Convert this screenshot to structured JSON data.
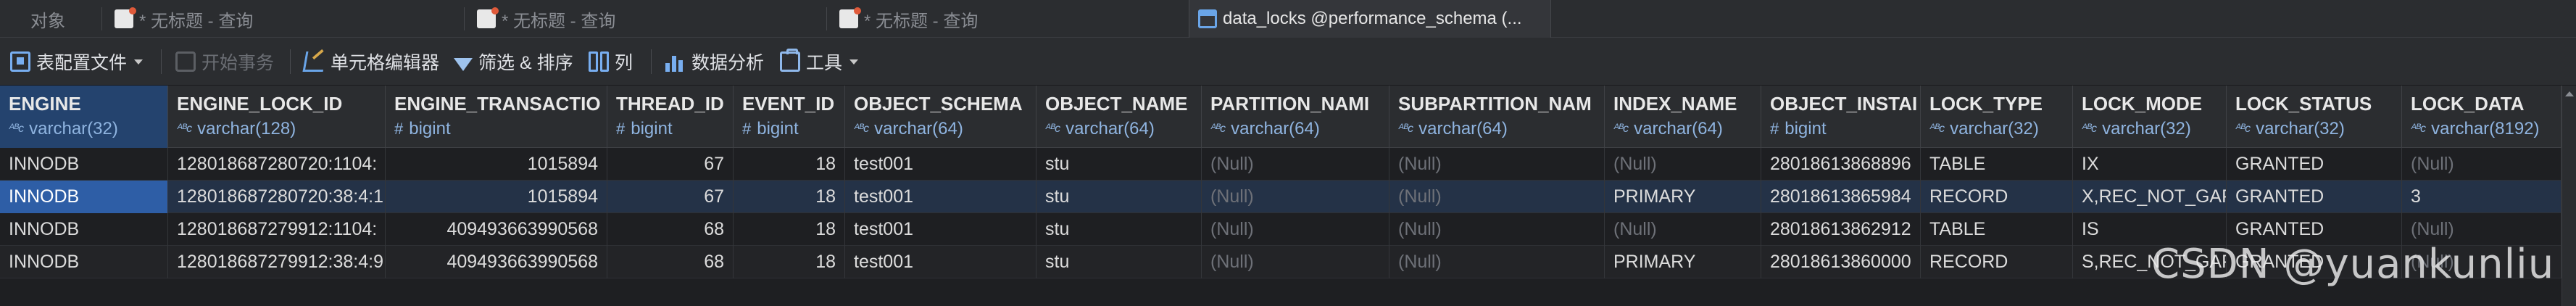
{
  "tabs": [
    {
      "label": "对象"
    },
    {
      "label": "* 无标题 - 查询"
    },
    {
      "label": "* 无标题 - 查询"
    },
    {
      "label": "* 无标题 - 查询"
    },
    {
      "label": "data_locks @performance_schema (..."
    }
  ],
  "toolbar": {
    "import_label": "表配置文件",
    "start_tx_label": "开始事务",
    "cell_editor_label": "单元格编辑器",
    "filter_sort_label": "筛选 & 排序",
    "columns_label": "列",
    "data_analysis_label": "数据分析",
    "tools_label": "工具"
  },
  "columns": [
    {
      "name": "ENGINE",
      "type": "varchar(32)",
      "icon": "string-icon"
    },
    {
      "name": "ENGINE_LOCK_ID",
      "type": "varchar(128)",
      "icon": "string-icon"
    },
    {
      "name": "ENGINE_TRANSACTIO",
      "type": "bigint",
      "icon": "number-icon"
    },
    {
      "name": "THREAD_ID",
      "type": "bigint",
      "icon": "number-icon"
    },
    {
      "name": "EVENT_ID",
      "type": "bigint",
      "icon": "number-icon"
    },
    {
      "name": "OBJECT_SCHEMA",
      "type": "varchar(64)",
      "icon": "string-icon"
    },
    {
      "name": "OBJECT_NAME",
      "type": "varchar(64)",
      "icon": "string-icon"
    },
    {
      "name": "PARTITION_NAMI",
      "type": "varchar(64)",
      "icon": "string-icon"
    },
    {
      "name": "SUBPARTITION_NAM",
      "type": "varchar(64)",
      "icon": "string-icon"
    },
    {
      "name": "INDEX_NAME",
      "type": "varchar(64)",
      "icon": "string-icon"
    },
    {
      "name": "OBJECT_INSTAI",
      "type": "bigint",
      "icon": "number-icon"
    },
    {
      "name": "LOCK_TYPE",
      "type": "varchar(32)",
      "icon": "string-icon"
    },
    {
      "name": "LOCK_MODE",
      "type": "varchar(32)",
      "icon": "string-icon"
    },
    {
      "name": "LOCK_STATUS",
      "type": "varchar(32)",
      "icon": "string-icon"
    },
    {
      "name": "LOCK_DATA",
      "type": "varchar(8192)",
      "icon": "string-icon"
    }
  ],
  "rows": [
    [
      "INNODB",
      "128018687280720:1104:",
      "1015894",
      "67",
      "18",
      "test001",
      "stu",
      "(Null)",
      "(Null)",
      "(Null)",
      "28018613868896",
      "TABLE",
      "IX",
      "GRANTED",
      "(Null)"
    ],
    [
      "INNODB",
      "128018687280720:38:4:1",
      "1015894",
      "67",
      "18",
      "test001",
      "stu",
      "(Null)",
      "(Null)",
      "PRIMARY",
      "28018613865984",
      "RECORD",
      "X,REC_NOT_GAP",
      "GRANTED",
      "3"
    ],
    [
      "INNODB",
      "128018687279912:1104:",
      "409493663990568",
      "68",
      "18",
      "test001",
      "stu",
      "(Null)",
      "(Null)",
      "(Null)",
      "28018613862912",
      "TABLE",
      "IS",
      "GRANTED",
      "(Null)"
    ],
    [
      "INNODB",
      "128018687279912:38:4:9",
      "409493663990568",
      "68",
      "18",
      "test001",
      "stu",
      "(Null)",
      "(Null)",
      "PRIMARY",
      "28018613860000",
      "RECORD",
      "S,REC_NOT_GAP",
      "GRANTED",
      "(Null)"
    ]
  ],
  "selected_row": 1,
  "watermark": "CSDN @yuankunliu",
  "colors": {
    "background": "#1e1f22",
    "header": "#2b2d30",
    "selection": "#2e5ea6",
    "type_text": "#8fb4e0"
  }
}
